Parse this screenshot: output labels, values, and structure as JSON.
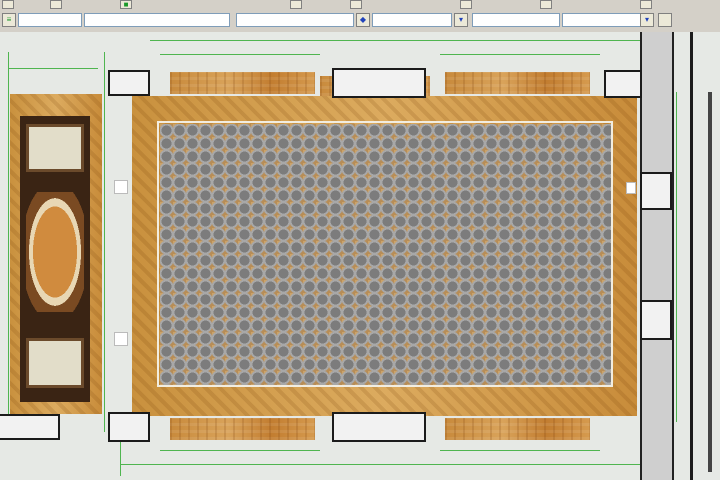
{
  "toolbar": {
    "layer_value": "",
    "coord_value": "",
    "style_value": "",
    "scale_value": "",
    "zoom_value": ""
  },
  "icons": {
    "layer": "layer-icon",
    "properties": "properties-icon",
    "dropdown": "chevron-down-icon",
    "match": "match-properties-icon"
  },
  "drawing": {
    "border_color": "#c88a3c",
    "field_color": "#b78d57",
    "tile_color": "#7c7c7c",
    "dimension_color": "#4fb54f",
    "inlay_color": "#3a2414"
  }
}
